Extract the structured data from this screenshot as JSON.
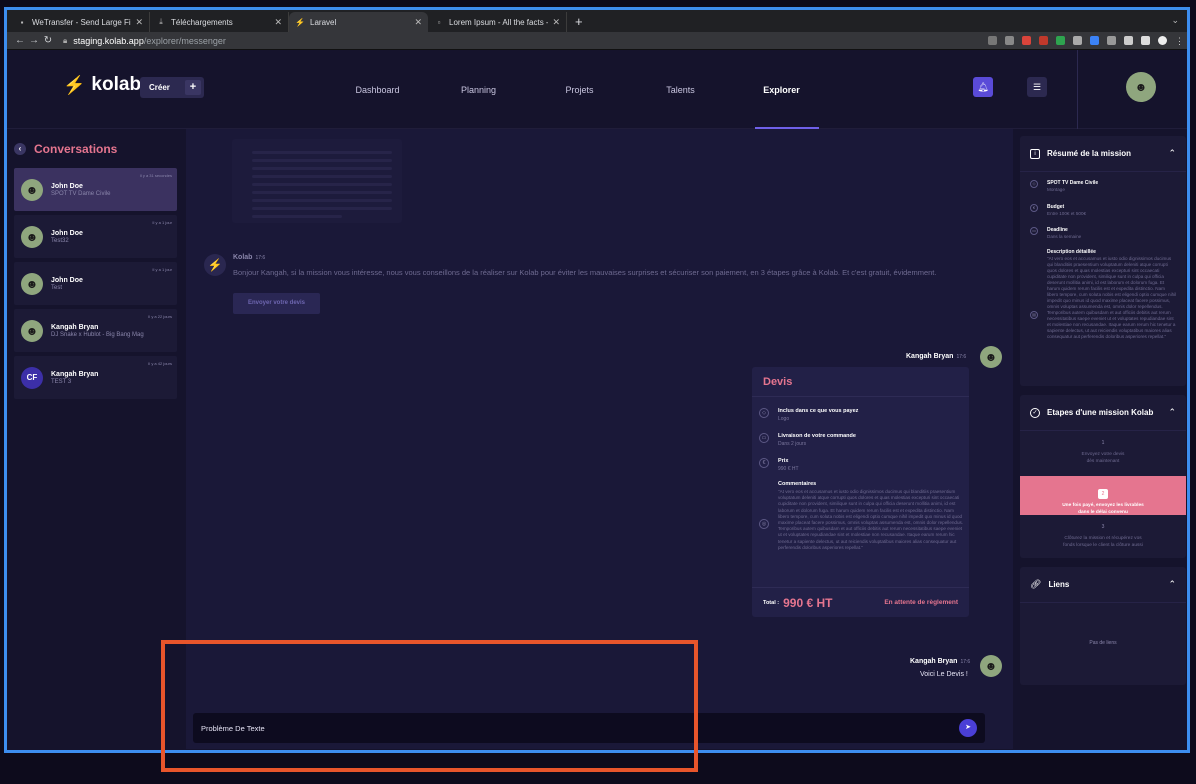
{
  "browser": {
    "tabs": [
      {
        "label": "WeTransfer - Send Large Files",
        "icon": "wetransfer-icon"
      },
      {
        "label": "Téléchargements",
        "icon": "download-icon"
      },
      {
        "label": "Laravel",
        "icon": "kolab-icon"
      },
      {
        "label": "Lorem Ipsum - All the facts - L",
        "icon": "page-icon"
      }
    ],
    "url_host": "staging.kolab.app",
    "url_path": "/explorer/messenger"
  },
  "header": {
    "logo": "kolab",
    "create_label": "Créer",
    "create_plus": "+",
    "nav": [
      "Dashboard",
      "Planning",
      "Projets",
      "Talents",
      "Explorer"
    ],
    "active_nav": "Explorer"
  },
  "sidebar": {
    "title": "Conversations",
    "conversations": [
      {
        "name": "John Doe",
        "subtitle": "SPOT TV Dame Civile",
        "time": "Il y a 31 secondes",
        "selected": true,
        "avatar": "photo"
      },
      {
        "name": "John Doe",
        "subtitle": "Test32",
        "time": "Il y a 1 jour",
        "selected": false,
        "avatar": "photo"
      },
      {
        "name": "John Doe",
        "subtitle": "Test",
        "time": "Il y a 1 jour",
        "selected": false,
        "avatar": "photo"
      },
      {
        "name": "Kangah Bryan",
        "subtitle": "DJ Snake x Hublot - Big Bang Mag",
        "time": "Il y a 22 jours",
        "selected": false,
        "avatar": "photo"
      },
      {
        "name": "Kangah Bryan",
        "subtitle": "TEST 3",
        "time": "Il y a 42 jours",
        "selected": false,
        "avatar": "CF"
      }
    ]
  },
  "chat": {
    "kolab_message": {
      "sender": "Kolab",
      "time": "17:6",
      "text": "Bonjour Kangah, si la mission vous intéresse, nous vous conseillons de la réaliser sur Kolab pour éviter les mauvaises surprises et sécuriser son paiement, en 3 étapes grâce à Kolab. Et c'est gratuit, évidemment.",
      "button": "Envoyer votre devis"
    },
    "devis": {
      "sender": "Kangah Bryan",
      "time": "17:6",
      "title": "Devis",
      "included_label": "Inclus dans ce que vous payez",
      "included_value": "Logo",
      "delivery_label": "Livraison de votre commande",
      "delivery_value": "Dans 2 jours",
      "price_label": "Prix",
      "price_value": "990 € HT",
      "comments_label": "Commentaires",
      "comments_value": "\"At vero eos et accusamus et iusto odio dignissimos ducimus qui blanditiis praesentium voluptatum deleniti atque corrupti quos dolores et quas molestias excepturi sint occaecati cupiditate non provident, similique sunt in culpa qui officia deserunt mollitia animi, id est laborum et dolorum fuga. Et harum quidem rerum facilis est et expedita distinctio. Nam libero tempore, cum soluta nobis est eligendi optio cumque nihil impedit quo minus id quod maxime placeat facere possimus, omnis voluptas assumenda est, omnis dolor repellendus. Temporibus autem quibusdam et aut officiis debitis aut rerum necessitatibus saepe eveniet ut et voluptates repudiandae sint et molestiae non recusandae. Itaque earum rerum hic tenetur a sapiente delectus, ut aut reiciendis voluptatibus maiores alias consequatur aut perferendis doloribus asperiores repellat.\"",
      "total_label": "Total :",
      "total_value": "990 € HT",
      "status": "En attente de règlement"
    },
    "last_message": {
      "sender": "Kangah Bryan",
      "time": "17:6",
      "text": "Voici Le Devis !"
    },
    "composer_value": "Problème De Texte"
  },
  "mission": {
    "title": "Résumé de la mission",
    "project_label": "SPOT TV Dame Civile",
    "project_value": "Montage",
    "budget_label": "Budget",
    "budget_value": "Entre 100€ et 500€",
    "deadline_label": "Deadline",
    "deadline_value": "Dans la semaine",
    "desc_label": "Description détaillée",
    "desc_value": "\"At vero eos et accusamus et iusto odio dignissimos ducimus qui blanditiis praesentium voluptatum deleniti atque corrupti quos dolores et quas molestias excepturi sint occaecati cupiditate non provident, similique sunt in culpa qui officia deserunt mollitia animi, id est laborum et dolorum fuga. Et harum quidem rerum facilis est et expedita distinctio. Nam libero tempore, cum soluta nobis est eligendi optio cumque nihil impedit quo minus id quod maxime placeat facere possimus, omnis voluptas assumenda est, omnis dolor repellendus. Temporibus autem quibusdam et aut officiis debitis aut rerum necessitatibus saepe eveniet ut et voluptates repudiandae sint et molestiae non recusandae. Itaque earum rerum hic tenetur a sapiente delectus, ut aut reiciendis voluptatibus maiores alias consequatur aut perferendis doloribus asperiores repellat.\""
  },
  "steps": {
    "title": "Etapes d'une mission Kolab",
    "items": [
      {
        "num": "1",
        "text": "Envoyez votre devis\ndès maintenant"
      },
      {
        "num": "2",
        "text": "Une fois payé, envoyez les livrables\ndans le délai convenu"
      },
      {
        "num": "3",
        "text": "Clôturez la mission et récupérez vos\nfonds lorsque le client la clôture aussi"
      }
    ],
    "active_step": 2
  },
  "links": {
    "title": "Liens",
    "empty": "Pas de liens"
  },
  "colors": {
    "accent": "#6f60e8",
    "pink": "#e5758f",
    "highlight_box": "#e8552b",
    "frame_box": "#3d8ef0"
  }
}
